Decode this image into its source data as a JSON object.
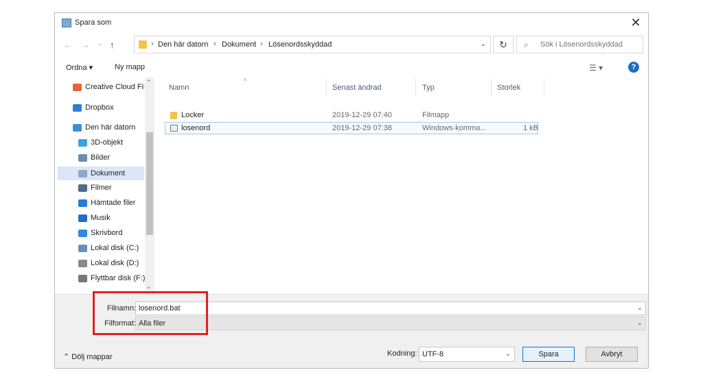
{
  "window": {
    "title": "Spara som",
    "close": "✕"
  },
  "nav": {
    "back": "←",
    "forward": "→",
    "recent": "⌄",
    "up": "↑",
    "breadcrumb": [
      "Den här datorn",
      "Dokument",
      "Lösenordsskyddad"
    ],
    "separator": "›",
    "dropdown": "⌄",
    "refresh": "↻",
    "search_placeholder": "Sök i Lösenordsskyddad"
  },
  "toolbar": {
    "organize": "Ordna ▾",
    "new_folder": "Ny mapp",
    "view": "☰ ▾",
    "help": "?"
  },
  "sidebar": {
    "items": [
      {
        "label": "Creative Cloud Files",
        "icon": "creative-cloud-icon",
        "color": "#e8643a"
      },
      {
        "label": "Dropbox",
        "icon": "dropbox-icon",
        "color": "#2f7fd1"
      },
      {
        "label": "Den här datorn",
        "icon": "computer-icon",
        "color": "#3d8ed8"
      },
      {
        "label": "3D-objekt",
        "icon": "cube-icon",
        "color": "#3fa0e0"
      },
      {
        "label": "Bilder",
        "icon": "pictures-icon",
        "color": "#6d8bb2"
      },
      {
        "label": "Dokument",
        "icon": "document-icon",
        "color": "#8fa9c4"
      },
      {
        "label": "Filmer",
        "icon": "video-icon",
        "color": "#4d6b8d"
      },
      {
        "label": "Hämtade filer",
        "icon": "download-icon",
        "color": "#2a7bd4"
      },
      {
        "label": "Musik",
        "icon": "music-icon",
        "color": "#1f6fc9"
      },
      {
        "label": "Skrivbord",
        "icon": "desktop-icon",
        "color": "#2f8ae0"
      },
      {
        "label": "Lokal disk (C:)",
        "icon": "windows-drive-icon",
        "color": "#6a8fb6"
      },
      {
        "label": "Lokal disk (D:)",
        "icon": "drive-icon",
        "color": "#8a8a8a"
      },
      {
        "label": "Flyttbar disk (F:)",
        "icon": "removable-drive-icon",
        "color": "#777777"
      }
    ],
    "selected": "Dokument"
  },
  "files": {
    "columns": [
      "Namn",
      "Senast ändrad",
      "Typ",
      "Storlek"
    ],
    "rows": [
      {
        "name": "Locker",
        "modified": "2019-12-29 07:40",
        "type": "Filmapp",
        "size": "",
        "icon": "folder-icon"
      },
      {
        "name": "losenord",
        "modified": "2019-12-29 07:38",
        "type": "Windows-komma...",
        "size": "1 kB",
        "icon": "batch-file-icon"
      }
    ]
  },
  "form": {
    "filename_label": "Filnamn:",
    "filename_value": "losenord.bat",
    "filetype_label": "Filformat:",
    "filetype_value": "Alla filer",
    "hide_folders": "⌃ Dölj mappar",
    "encoding_label": "Kodning:",
    "encoding_value": "UTF-8",
    "save_button": "Spara",
    "cancel_button": "Avbryt"
  },
  "colors": {
    "highlight": "#e02020",
    "accent": "#0078d7",
    "folder": "#f0c54a"
  }
}
